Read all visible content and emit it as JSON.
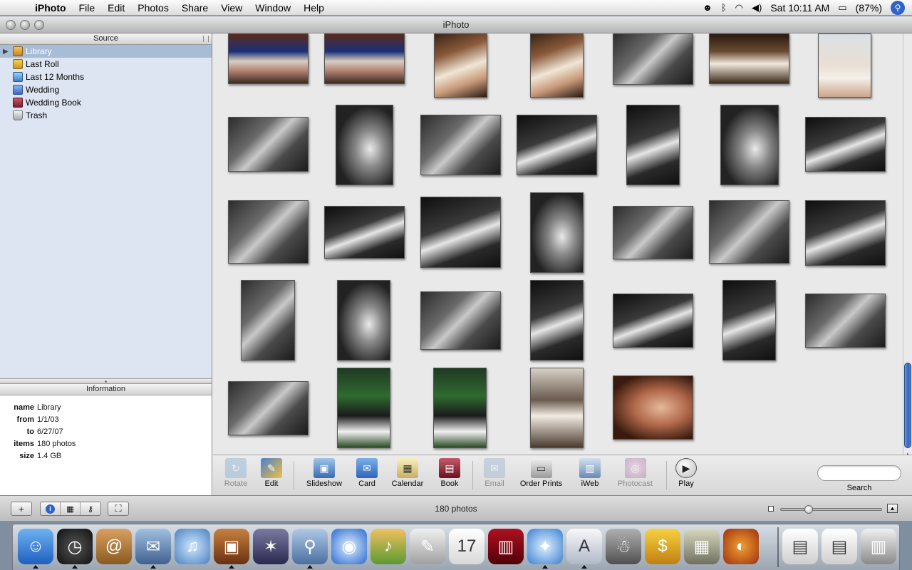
{
  "menubar": {
    "app": "iPhoto",
    "items": [
      "File",
      "Edit",
      "Photos",
      "Share",
      "View",
      "Window",
      "Help"
    ],
    "clock": "Sat 10:11 AM",
    "battery": "(87%)"
  },
  "window": {
    "title": "iPhoto"
  },
  "source": {
    "header": "Source",
    "items": [
      {
        "label": "Library",
        "icon": "library-icon",
        "selected": true
      },
      {
        "label": "Last Roll",
        "icon": "roll-icon"
      },
      {
        "label": "Last 12 Months",
        "icon": "calendar-icon"
      },
      {
        "label": "Wedding",
        "icon": "album-icon"
      },
      {
        "label": "Wedding Book",
        "icon": "book-icon"
      },
      {
        "label": "Trash",
        "icon": "trash-icon"
      }
    ]
  },
  "information": {
    "header": "Information",
    "rows": [
      {
        "key": "name",
        "value": "Library"
      },
      {
        "key": "from",
        "value": "1/1/03"
      },
      {
        "key": "to",
        "value": "6/27/07"
      },
      {
        "key": "items",
        "value": "180 photos"
      },
      {
        "key": "size",
        "value": "1.4 GB"
      }
    ]
  },
  "toolbar": {
    "tools": [
      {
        "label": "Rotate",
        "icon": "rotate-icon",
        "enabled": false
      },
      {
        "label": "Edit",
        "icon": "edit-icon",
        "enabled": true
      },
      {
        "label": "Slideshow",
        "icon": "slideshow-icon",
        "enabled": true
      },
      {
        "label": "Card",
        "icon": "card-icon",
        "enabled": true
      },
      {
        "label": "Calendar",
        "icon": "calendar-icon",
        "enabled": true
      },
      {
        "label": "Book",
        "icon": "book-icon",
        "enabled": true
      },
      {
        "label": "Email",
        "icon": "email-icon",
        "enabled": false
      },
      {
        "label": "Order Prints",
        "icon": "prints-icon",
        "enabled": true
      },
      {
        "label": "iWeb",
        "icon": "iweb-icon",
        "enabled": true
      },
      {
        "label": "Photocast",
        "icon": "photocast-icon",
        "enabled": false
      },
      {
        "label": "Play",
        "icon": "play-icon",
        "enabled": true
      }
    ],
    "search_label": "Search",
    "search_placeholder": ""
  },
  "statusbar": {
    "count": "180 photos",
    "zoom_level": 0.25
  },
  "dock": {
    "apps": [
      "finder-icon",
      "dashboard-icon",
      "address-book-icon",
      "mail-icon",
      "itunes-icon",
      "iphoto-icon",
      "imovie-icon",
      "preview-icon",
      "idvd-icon",
      "garageband-icon",
      "iweb-icon",
      "ical-icon",
      "photo-booth-icon",
      "safari-icon",
      "textedit-icon",
      "automator-icon",
      "money-icon",
      "calculator-icon",
      "firefox-icon",
      "document-icon",
      "document-icon-2",
      "trash-icon"
    ]
  },
  "colors": {
    "selection": "#a7bdd6",
    "source_background": "#dce5f1",
    "accent": "#2f63c8"
  }
}
